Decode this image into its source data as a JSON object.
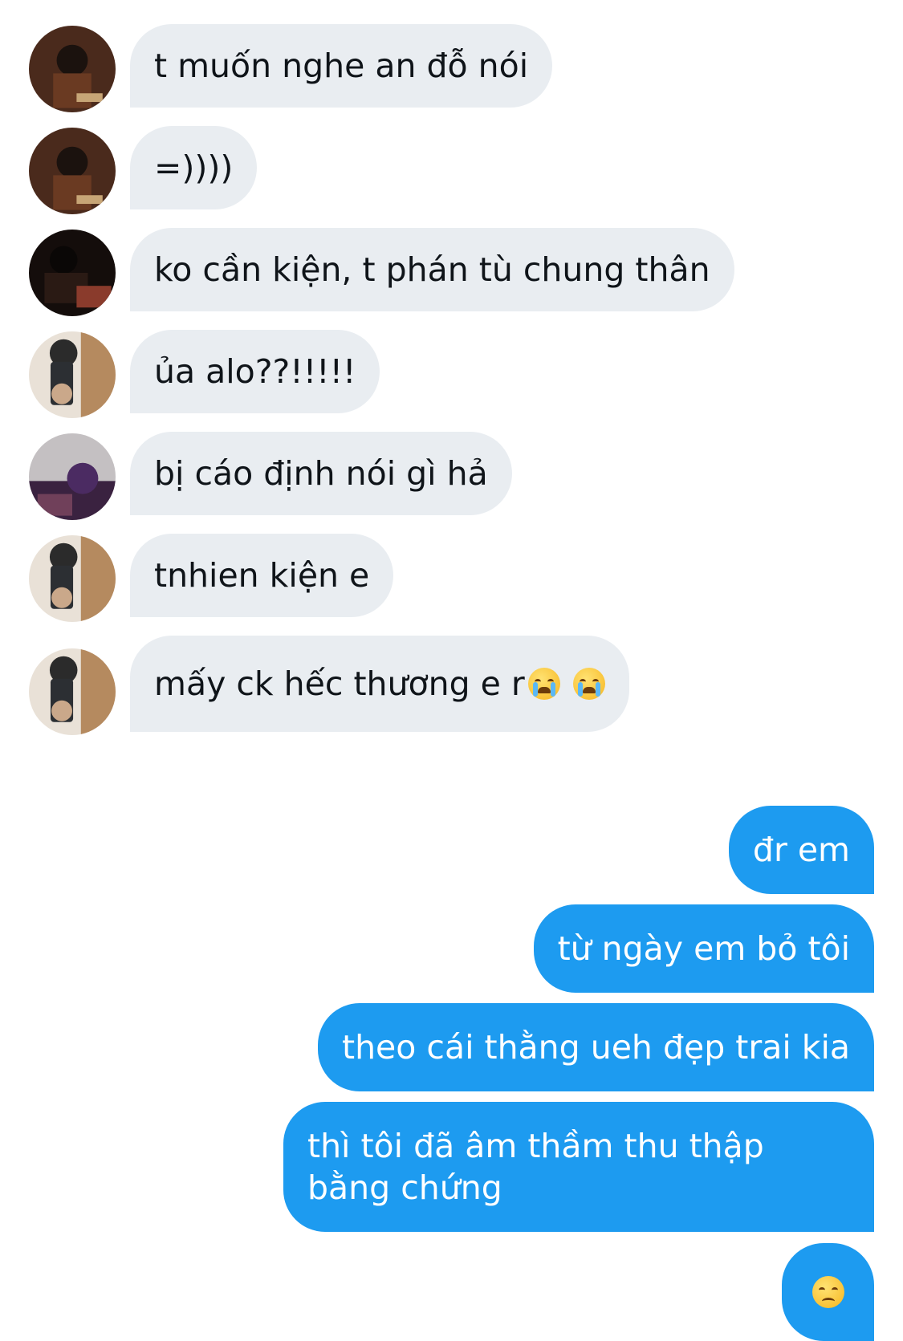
{
  "messages": [
    {
      "side": "in",
      "text": "t muốn nghe an đỗ nói",
      "avatar": "avatar-a"
    },
    {
      "side": "in",
      "text": "=))))",
      "avatar": "avatar-a"
    },
    {
      "side": "in",
      "text": "ko cần kiện, t phán tù chung thân",
      "avatar": "avatar-b"
    },
    {
      "side": "in",
      "text": "ủa alo??!!!!!",
      "avatar": "avatar-c"
    },
    {
      "side": "in",
      "text": "bị cáo định nói gì hả",
      "avatar": "avatar-d"
    },
    {
      "side": "in",
      "text": "tnhien kiện e",
      "avatar": "avatar-c"
    },
    {
      "side": "in",
      "text": "mấy ck hếc thương e r",
      "emoji": [
        "loudly-crying-face-icon",
        "loudly-crying-face-icon"
      ],
      "avatar": "avatar-c"
    },
    {
      "side": "out",
      "text": "đr em"
    },
    {
      "side": "out",
      "text": "từ ngày em bỏ tôi"
    },
    {
      "side": "out",
      "text": "theo cái thằng ueh đẹp trai kia"
    },
    {
      "side": "out",
      "text": "thì tôi đã âm thầm thu thập bằng chứng"
    },
    {
      "side": "out",
      "text": "",
      "emoji": [
        "disappointed-face-icon"
      ]
    }
  ],
  "colors": {
    "incoming_bubble": "#e9edf1",
    "outgoing_bubble": "#1d9bf0",
    "incoming_text": "#0f1419",
    "outgoing_text": "#ffffff"
  }
}
